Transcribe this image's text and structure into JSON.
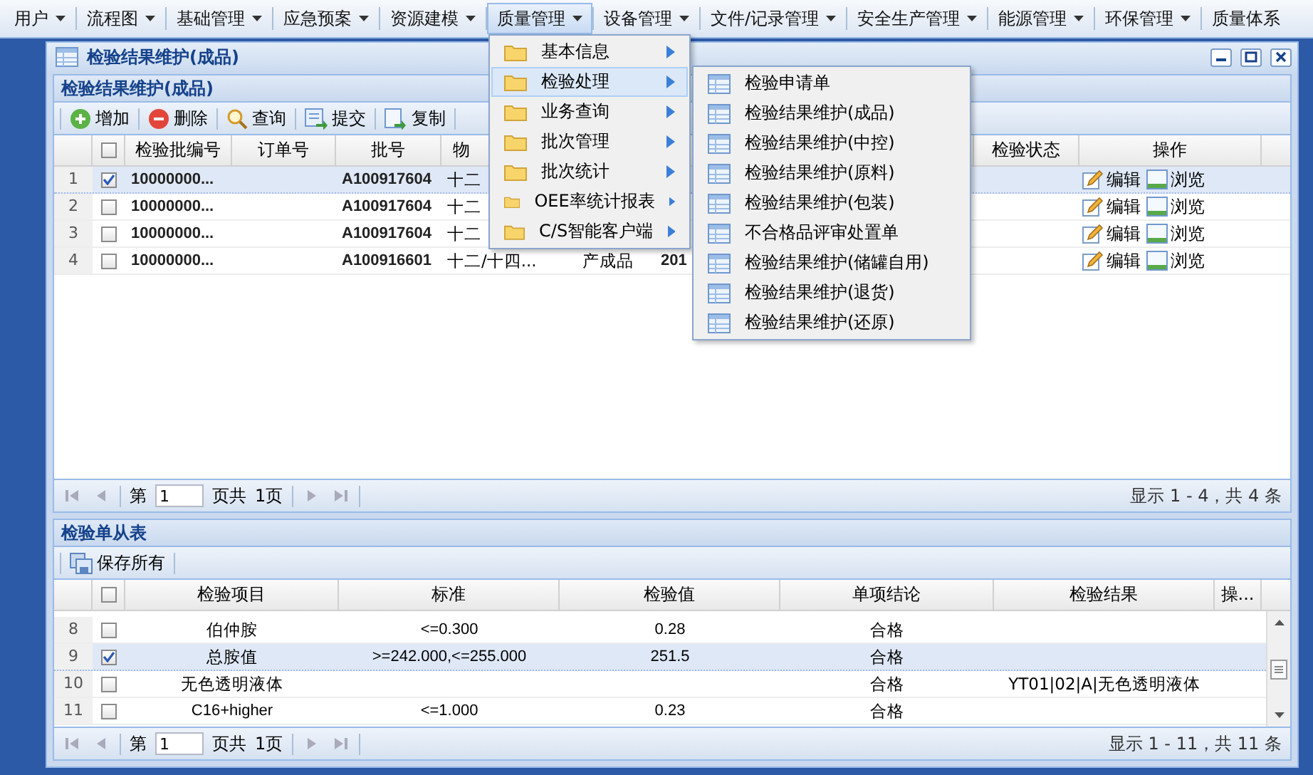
{
  "menubar": {
    "items": [
      {
        "label": "用户",
        "selected": false
      },
      {
        "label": "流程图",
        "selected": false
      },
      {
        "label": "基础管理",
        "selected": false
      },
      {
        "label": "应急预案",
        "selected": false
      },
      {
        "label": "资源建模",
        "selected": false
      },
      {
        "label": "质量管理",
        "selected": true
      },
      {
        "label": "设备管理",
        "selected": false
      },
      {
        "label": "文件/记录管理",
        "selected": false
      },
      {
        "label": "安全生产管理",
        "selected": false
      },
      {
        "label": "能源管理",
        "selected": false
      },
      {
        "label": "环保管理",
        "selected": false
      },
      {
        "label": "质量体系",
        "selected": false
      }
    ]
  },
  "window": {
    "title": "检验结果维护(成品)"
  },
  "main_panel": {
    "title": "检验结果维护(成品)",
    "toolbar": [
      {
        "label": "增加",
        "kind": "add"
      },
      {
        "label": "删除",
        "kind": "delete"
      },
      {
        "label": "查询",
        "kind": "search"
      },
      {
        "label": "提交",
        "kind": "submit"
      },
      {
        "label": "复制",
        "kind": "copy"
      }
    ],
    "table": {
      "select_all": {
        "checked": false
      },
      "columns": [
        "检验批编号",
        "订单号",
        "批号",
        "物",
        "检验状态",
        "操作"
      ],
      "rows": [
        {
          "number": "1",
          "checked": true,
          "selected": true,
          "batch_code": "10000000...",
          "lot": "A100917604",
          "column_4": "十二",
          "actions": [
            "编辑",
            "浏览"
          ]
        },
        {
          "number": "2",
          "checked": false,
          "selected": false,
          "batch_code": "10000000...",
          "lot": "A100917604",
          "column_4": "十二",
          "actions": [
            "编辑",
            "浏览"
          ]
        },
        {
          "number": "3",
          "checked": false,
          "selected": false,
          "batch_code": "10000000...",
          "lot": "A100917604",
          "column_4": "十二",
          "actions": [
            "编辑",
            "浏览"
          ]
        },
        {
          "number": "4",
          "checked": false,
          "selected": false,
          "batch_code": "10000000...",
          "lot": "A100916601",
          "column_4": "十二/十四...",
          "column_5": "产成品",
          "column_6": "201",
          "actions": [
            "编辑",
            "浏览"
          ]
        }
      ]
    },
    "pager": {
      "page_label": "第",
      "page": "1",
      "of_label": "页共",
      "total_pages": "1页",
      "summary": "显示 1 - 4，共 4 条"
    }
  },
  "detail_panel": {
    "title": "检验单从表",
    "toolbar": [
      {
        "label": "保存所有",
        "kind": "save"
      }
    ],
    "table": {
      "select_all": {
        "checked": false
      },
      "columns": [
        "检验项目",
        "标准",
        "检验值",
        "单项结论",
        "检验结果",
        "操..."
      ],
      "rows": [
        {
          "number": "8",
          "checked": false,
          "selected": false,
          "item": "伯仲胺",
          "standard": "<=0.300",
          "value": "0.28",
          "conclusion": "合格"
        },
        {
          "number": "9",
          "checked": true,
          "selected": true,
          "item": "总胺值",
          "standard": ">=242.000,<=255.000",
          "value": "251.5",
          "conclusion": "合格"
        },
        {
          "number": "10",
          "checked": false,
          "selected": false,
          "item": "无色透明液体",
          "conclusion": "合格",
          "result": "YT01|02|A|无色透明液体"
        },
        {
          "number": "11",
          "checked": false,
          "selected": false,
          "item": "C16+higher",
          "standard": "<=1.000",
          "value": "0.23",
          "conclusion": "合格"
        }
      ]
    },
    "pager": {
      "page_label": "第",
      "page": "1",
      "of_label": "页共",
      "total_pages": "1页",
      "summary": "显示 1 - 11，共 11 条"
    }
  },
  "quality_menu": {
    "items": [
      {
        "label": "基本信息",
        "selected": false
      },
      {
        "label": "检验处理",
        "selected": true
      },
      {
        "label": "业务查询",
        "selected": false
      },
      {
        "label": "批次管理",
        "selected": false
      },
      {
        "label": "批次统计",
        "selected": false
      },
      {
        "label": "OEE率统计报表",
        "selected": false
      },
      {
        "label": "C/S智能客户端",
        "selected": false
      }
    ]
  },
  "inspection_submenu": {
    "items": [
      "检验申请单",
      "检验结果维护(成品)",
      "检验结果维护(中控)",
      "检验结果维护(原料)",
      "检验结果维护(包装)",
      "不合格品评审处置单",
      "检验结果维护(储罐自用)",
      "检验结果维护(退货)",
      "检验结果维护(还原)"
    ]
  }
}
